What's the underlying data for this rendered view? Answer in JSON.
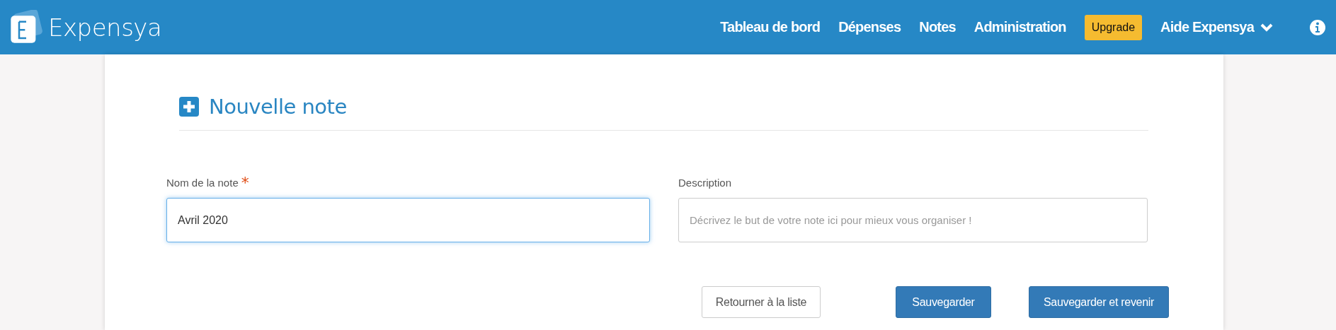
{
  "header": {
    "logo": "Expensya",
    "nav": [
      {
        "label": "Tableau de bord",
        "kind": "link"
      },
      {
        "label": "Dépenses",
        "kind": "link"
      },
      {
        "label": "Notes",
        "kind": "link"
      },
      {
        "label": "Administration",
        "kind": "link"
      },
      {
        "label": "Upgrade",
        "kind": "upgrade"
      },
      {
        "label": "Aide Expensya",
        "kind": "dropdown"
      }
    ]
  },
  "form": {
    "title": "Nouvelle note",
    "fields": [
      {
        "label": "Nom de la note",
        "required_mark": "*",
        "value": "Avril 2020",
        "focused": true
      },
      {
        "label": "Description",
        "placeholder": "Décrivez le but de votre note ici pour mieux vous organiser !",
        "focused": false
      }
    ],
    "buttons": [
      {
        "label": "Retourner à la liste",
        "kind": "secondary"
      },
      {
        "label": "Sauvegarder",
        "kind": "primary"
      },
      {
        "label": "Sauvegarder et revenir",
        "kind": "primary"
      }
    ]
  }
}
